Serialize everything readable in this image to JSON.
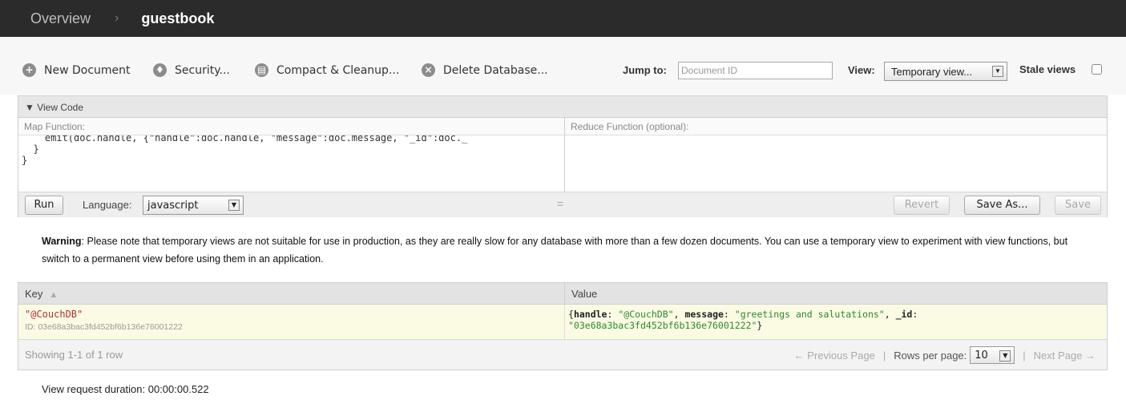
{
  "breadcrumb": {
    "root": "Overview",
    "separator": "›",
    "database": "guestbook"
  },
  "toolbar": {
    "new_document": "New Document",
    "security": "Security...",
    "compact": "Compact & Cleanup...",
    "delete_database": "Delete Database...",
    "jump_label": "Jump to:",
    "jump_placeholder": "Document ID",
    "view_label": "View:",
    "view_selected": "Temporary view...",
    "stale_label": "Stale views",
    "stale_checked": false
  },
  "view_code": {
    "header": "▼ View Code",
    "map_label": "Map Function:",
    "reduce_label": "Reduce Function (optional):",
    "map_lines": [
      "    emit(doc.handle, {\"handle\":doc.handle, \"message\":doc.message, \"_id\":doc._",
      "  }",
      "}"
    ],
    "reduce_code": "",
    "run_label": "Run",
    "language_label": "Language:",
    "language_selected": "javascript",
    "resize_handle": "=",
    "revert_label": "Revert",
    "save_as_label": "Save As...",
    "save_label": "Save"
  },
  "warning": {
    "prefix": "Warning",
    "text": ": Please note that temporary views are not suitable for use in production, as they are really slow for any database with more than a few dozen documents. You can use a temporary view to experiment with view functions, but switch to a permanent view before using them in an application."
  },
  "results": {
    "key_header": "Key",
    "value_header": "Value",
    "rows": [
      {
        "key": "\"@CouchDB\"",
        "id_line": "ID: 03e68a3bac3fd452bf6b136e76001222",
        "value_line1_parts": [
          "{",
          "handle",
          ": ",
          "\"@CouchDB\"",
          ", ",
          "message",
          ": ",
          "\"greetings and salutations\"",
          ", ",
          "_id",
          ":"
        ],
        "value_line2": "\"03e68a3bac3fd452bf6b136e76001222\"",
        "value_close": "}"
      }
    ],
    "showing": "Showing 1-1 of 1 row",
    "prev_page": "← Previous Page",
    "pipe": "|",
    "rows_per_page_label": "Rows per page:",
    "rows_per_page": "10",
    "next_page": "Next Page →"
  },
  "duration": "View request duration:  00:00:00.522",
  "icons": {
    "new_document": "plus-circle-icon",
    "security": "shield-icon",
    "compact": "compact-icon",
    "delete": "x-circle-icon"
  }
}
